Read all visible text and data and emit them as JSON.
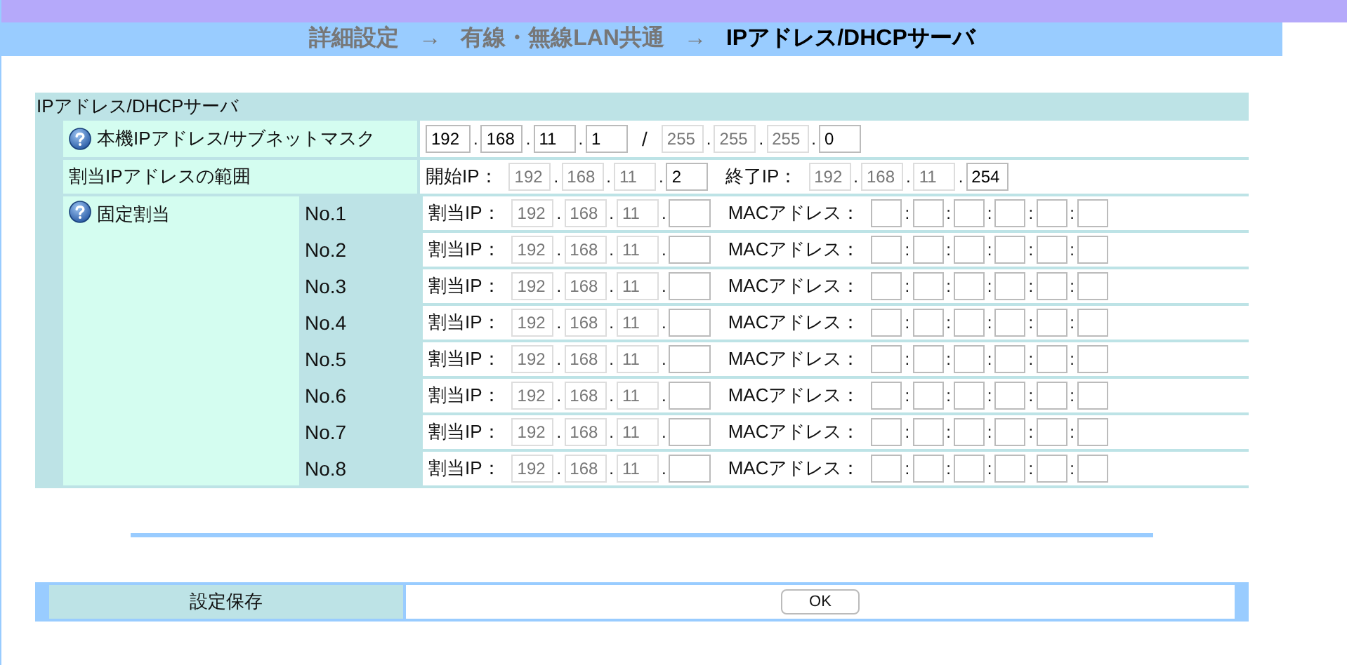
{
  "breadcrumb": [
    {
      "label": "詳細設定",
      "current": false
    },
    {
      "label": "→",
      "current": false
    },
    {
      "label": "有線・無線LAN共通",
      "current": false
    },
    {
      "label": "→",
      "current": false
    },
    {
      "label": "IPアドレス/DHCPサーバ",
      "current": true
    }
  ],
  "table": {
    "title": "IPアドレス/DHCPサーバ",
    "host": {
      "label": "本機IPアドレス/サブネットマスク",
      "fields": [
        {
          "value": "192",
          "disabled": false,
          "sep": "."
        },
        {
          "value": "168",
          "disabled": false,
          "sep": "."
        },
        {
          "value": "11",
          "disabled": false,
          "sep": "."
        },
        {
          "value": "1",
          "disabled": false,
          "sep": "/"
        },
        {
          "value": "255",
          "disabled": true,
          "sep": "."
        },
        {
          "value": "255",
          "disabled": true,
          "sep": "."
        },
        {
          "value": "255",
          "disabled": true,
          "sep": "."
        },
        {
          "value": "0",
          "disabled": false
        }
      ]
    },
    "range": {
      "label": "割当IPアドレスの範囲",
      "start_label": "開始IP：",
      "start": [
        {
          "value": "192",
          "disabled": true,
          "sep": "."
        },
        {
          "value": "168",
          "disabled": true,
          "sep": "."
        },
        {
          "value": "11",
          "disabled": true,
          "sep": "."
        },
        {
          "value": "2",
          "disabled": false
        }
      ],
      "end_label": "終了IP：",
      "end": [
        {
          "value": "192",
          "disabled": true,
          "sep": "."
        },
        {
          "value": "168",
          "disabled": true,
          "sep": "."
        },
        {
          "value": "11",
          "disabled": true,
          "sep": "."
        },
        {
          "value": "254",
          "disabled": false
        }
      ]
    },
    "fixed": {
      "label": "固定割当",
      "entries": [
        {
          "no": "No.1",
          "ip_label": "割当IP：",
          "ip": [
            {
              "value": "192",
              "disabled": true,
              "sep": "."
            },
            {
              "value": "168",
              "disabled": true,
              "sep": "."
            },
            {
              "value": "11",
              "disabled": true,
              "sep": "."
            },
            {
              "disabled": false
            }
          ],
          "mac_label": "MACアドレス：",
          "mac": [
            {
              "sep": ":"
            },
            {
              "sep": ":"
            },
            {
              "sep": ":"
            },
            {
              "sep": ":"
            },
            {
              "sep": ":"
            },
            {
              "disabled": false
            }
          ]
        },
        {
          "no": "No.2",
          "ip_label": "割当IP：",
          "ip": [
            {
              "value": "192",
              "disabled": true,
              "sep": "."
            },
            {
              "value": "168",
              "disabled": true,
              "sep": "."
            },
            {
              "value": "11",
              "disabled": true,
              "sep": "."
            },
            {
              "disabled": false
            }
          ],
          "mac_label": "MACアドレス：",
          "mac": [
            {
              "sep": ":"
            },
            {
              "sep": ":"
            },
            {
              "sep": ":"
            },
            {
              "sep": ":"
            },
            {
              "sep": ":"
            },
            {
              "disabled": false
            }
          ]
        },
        {
          "no": "No.3",
          "ip_label": "割当IP：",
          "ip": [
            {
              "value": "192",
              "disabled": true,
              "sep": "."
            },
            {
              "value": "168",
              "disabled": true,
              "sep": "."
            },
            {
              "value": "11",
              "disabled": true,
              "sep": "."
            },
            {
              "disabled": false
            }
          ],
          "mac_label": "MACアドレス：",
          "mac": [
            {
              "sep": ":"
            },
            {
              "sep": ":"
            },
            {
              "sep": ":"
            },
            {
              "sep": ":"
            },
            {
              "sep": ":"
            },
            {
              "disabled": false
            }
          ]
        },
        {
          "no": "No.4",
          "ip_label": "割当IP：",
          "ip": [
            {
              "value": "192",
              "disabled": true,
              "sep": "."
            },
            {
              "value": "168",
              "disabled": true,
              "sep": "."
            },
            {
              "value": "11",
              "disabled": true,
              "sep": "."
            },
            {
              "disabled": false
            }
          ],
          "mac_label": "MACアドレス：",
          "mac": [
            {
              "sep": ":"
            },
            {
              "sep": ":"
            },
            {
              "sep": ":"
            },
            {
              "sep": ":"
            },
            {
              "sep": ":"
            },
            {
              "disabled": false
            }
          ]
        },
        {
          "no": "No.5",
          "ip_label": "割当IP：",
          "ip": [
            {
              "value": "192",
              "disabled": true,
              "sep": "."
            },
            {
              "value": "168",
              "disabled": true,
              "sep": "."
            },
            {
              "value": "11",
              "disabled": true,
              "sep": "."
            },
            {
              "disabled": false
            }
          ],
          "mac_label": "MACアドレス：",
          "mac": [
            {
              "sep": ":"
            },
            {
              "sep": ":"
            },
            {
              "sep": ":"
            },
            {
              "sep": ":"
            },
            {
              "sep": ":"
            },
            {
              "disabled": false
            }
          ]
        },
        {
          "no": "No.6",
          "ip_label": "割当IP：",
          "ip": [
            {
              "value": "192",
              "disabled": true,
              "sep": "."
            },
            {
              "value": "168",
              "disabled": true,
              "sep": "."
            },
            {
              "value": "11",
              "disabled": true,
              "sep": "."
            },
            {
              "disabled": false
            }
          ],
          "mac_label": "MACアドレス：",
          "mac": [
            {
              "sep": ":"
            },
            {
              "sep": ":"
            },
            {
              "sep": ":"
            },
            {
              "sep": ":"
            },
            {
              "sep": ":"
            },
            {
              "disabled": false
            }
          ]
        },
        {
          "no": "No.7",
          "ip_label": "割当IP：",
          "ip": [
            {
              "value": "192",
              "disabled": true,
              "sep": "."
            },
            {
              "value": "168",
              "disabled": true,
              "sep": "."
            },
            {
              "value": "11",
              "disabled": true,
              "sep": "."
            },
            {
              "disabled": false
            }
          ],
          "mac_label": "MACアドレス：",
          "mac": [
            {
              "sep": ":"
            },
            {
              "sep": ":"
            },
            {
              "sep": ":"
            },
            {
              "sep": ":"
            },
            {
              "sep": ":"
            },
            {
              "disabled": false
            }
          ]
        },
        {
          "no": "No.8",
          "ip_label": "割当IP：",
          "ip": [
            {
              "value": "192",
              "disabled": true,
              "sep": "."
            },
            {
              "value": "168",
              "disabled": true,
              "sep": "."
            },
            {
              "value": "11",
              "disabled": true,
              "sep": "."
            },
            {
              "disabled": false
            }
          ],
          "mac_label": "MACアドレス：",
          "mac": [
            {
              "sep": ":"
            },
            {
              "sep": ":"
            },
            {
              "sep": ":"
            },
            {
              "sep": ":"
            },
            {
              "sep": ":"
            },
            {
              "disabled": false
            }
          ]
        }
      ]
    }
  },
  "save": {
    "label": "設定保存",
    "button": "OK"
  }
}
